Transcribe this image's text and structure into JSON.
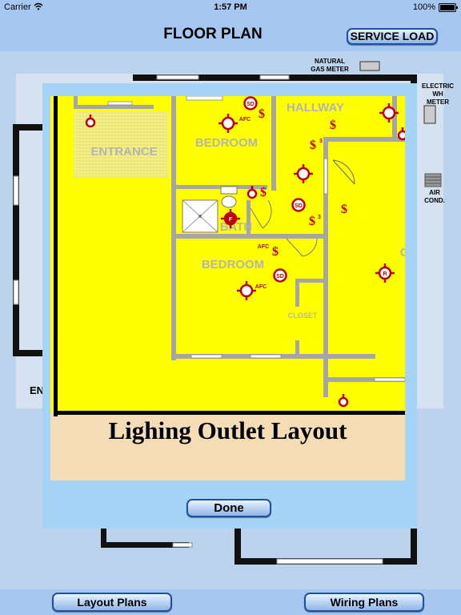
{
  "status": {
    "carrier": "Carrier",
    "time": "1:57 PM",
    "battery": "100%"
  },
  "header": {
    "title": "FLOOR PLAN",
    "service_load_label": "SERVICE LOAD"
  },
  "background": {
    "natural_gas_meter": [
      "NATURAL",
      "GAS METER"
    ],
    "electric_meter": [
      "ELECTRIC",
      "WH",
      "METER"
    ],
    "air_cond": [
      "AIR",
      "COND."
    ],
    "partial_label": "EN"
  },
  "modal": {
    "caption": "Lighing Outlet Layout",
    "done_label": "Done",
    "rooms": {
      "entrance": "ENTRANCE",
      "bedroom1": "BEDROOM",
      "hallway": "HALLWAY",
      "bath": "BATH",
      "bedroom2": "BEDROOM",
      "closet": "CLOSET"
    },
    "symbols": {
      "smoke": "SD",
      "afc": "AFC",
      "fan": "F",
      "recessed": "R",
      "switch": "$",
      "sub3": "3",
      "partial_c": "C"
    }
  },
  "footer": {
    "layout_plans_label": "Layout Plans",
    "wiring_plans_label": "Wiring Plans"
  }
}
